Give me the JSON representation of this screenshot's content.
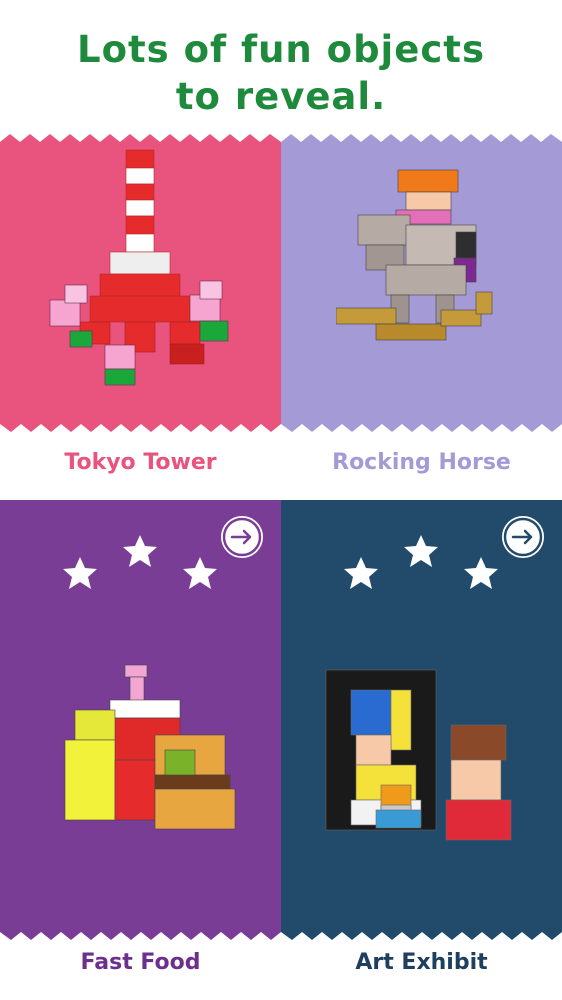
{
  "headline": {
    "line1": "Lots of fun objects",
    "line2": "to reveal."
  },
  "cards": [
    {
      "name": "Tokyo Tower",
      "bg": "#e8547e",
      "caption_color": "#e8547e",
      "stars": 0,
      "has_arrow": false
    },
    {
      "name": "Rocking Horse",
      "bg": "#a49ad6",
      "caption_color": "#a49ad6",
      "stars": 0,
      "has_arrow": false
    },
    {
      "name": "Fast Food",
      "bg": "#7a3d96",
      "caption_color": "#6d2f8e",
      "stars": 3,
      "has_arrow": true
    },
    {
      "name": "Art Exhibit",
      "bg": "#214a6b",
      "caption_color": "#1f3f60",
      "stars": 3,
      "has_arrow": true
    }
  ],
  "icons": {
    "arrow": "arrow-right-circle-icon",
    "star": "star-icon",
    "pattern": "robot-face-pattern-icon"
  },
  "colors": {
    "headline": "#1e8a3c"
  }
}
